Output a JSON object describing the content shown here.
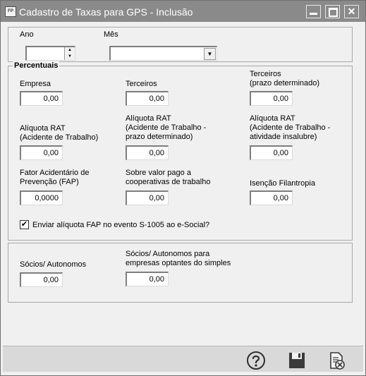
{
  "window": {
    "title": "Cadastro de Taxas para GPS - Inclusão",
    "app_icon": "FP"
  },
  "period": {
    "ano_label": "Ano",
    "mes_label": "Mês",
    "ano_value": "",
    "mes_value": ""
  },
  "percentuais": {
    "title": "Percentuais",
    "empresa": {
      "label": "Empresa",
      "value": "0,00"
    },
    "terceiros": {
      "label": "Terceiros",
      "value": "0,00"
    },
    "terceiros_prazo": {
      "label": "Terceiros\n(prazo determinado)",
      "value": "0,00"
    },
    "rat": {
      "label": "Alíquota RAT\n(Acidente de Trabalho)",
      "value": "0,00"
    },
    "rat_prazo": {
      "label": "Alíquota RAT\n(Acidente de Trabalho -\nprazo determinado)",
      "value": "0,00"
    },
    "rat_insalubre": {
      "label": "Alíquota RAT\n(Acidente de Trabalho -\natividade insalubre)",
      "value": "0,00"
    },
    "fap": {
      "label": "Fator Acidentário de\nPrevenção (FAP)",
      "value": "0,0000"
    },
    "cooperativas": {
      "label": "Sobre valor pago a\ncooperativas de trabalho",
      "value": "0,00"
    },
    "filantropia": {
      "label": "Isenção Filantropia",
      "value": "0,00"
    },
    "enviar_fap": {
      "label": "Enviar alíquota FAP no evento S-1005 ao e-Social?",
      "checked": true
    }
  },
  "socios": {
    "autonomos": {
      "label": "Sócios/ Autonomos",
      "value": "0,00"
    },
    "simples": {
      "label": "Sócios/ Autonomos para\nempresas optantes do simples",
      "value": "0,00"
    }
  },
  "toolbar": {
    "help_icon": "help-icon",
    "save_icon": "save-icon",
    "cancel_icon": "cancel-document-icon"
  }
}
